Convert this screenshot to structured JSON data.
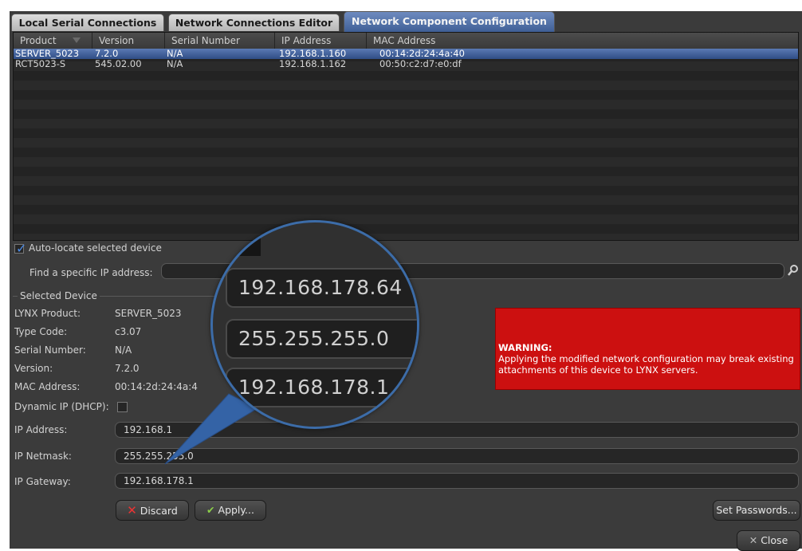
{
  "tabs": [
    {
      "label": "Local Serial Connections"
    },
    {
      "label": "Network Connections Editor"
    },
    {
      "label": "Network Component Configuration"
    }
  ],
  "table": {
    "headers": [
      "Product",
      "Version",
      "Serial Number",
      "IP Address",
      "MAC Address"
    ],
    "rows": [
      {
        "product": "SERVER_5023",
        "version": "7.2.0",
        "serial": "N/A",
        "ip": "192.168.1.160",
        "mac": "00:14:2d:24:4a:40"
      },
      {
        "product": "RCT5023-S",
        "version": "545.02.00",
        "serial": "N/A",
        "ip": "192.168.1.162",
        "mac": "00:50:c2:d7:e0:df"
      }
    ]
  },
  "auto_locate": {
    "label": "Auto-locate selected device",
    "checked": true
  },
  "find_ip": {
    "label": "Find a specific IP address:",
    "value": ""
  },
  "selected_device": {
    "title": "Selected Device",
    "labels": [
      "LYNX Product:",
      "Type Code:",
      "Serial Number:",
      "Version:",
      "MAC Address:"
    ],
    "values": [
      "SERVER_5023",
      "c3.07",
      "N/A",
      "7.2.0",
      "00:14:2d:24:4a:4"
    ]
  },
  "dhcp": {
    "label": "Dynamic IP (DHCP):",
    "checked": false
  },
  "ip_address": {
    "label": "IP Address:",
    "value": "192.168.1"
  },
  "ip_netmask": {
    "label": "IP Netmask:",
    "value": "255.255.255.0"
  },
  "ip_gateway": {
    "label": "IP Gateway:",
    "value": "192.168.178.1"
  },
  "warning": {
    "title": "WARNING:",
    "text": "Applying the modified network configuration may break existing attachments of this device to LYNX servers."
  },
  "zoom": {
    "ip": "192.168.178.64",
    "netmask": "255.255.255.0",
    "gateway": "192.168.178.1"
  },
  "buttons": {
    "discard": "Discard",
    "apply": "Apply...",
    "set_passwords": "Set Passwords...",
    "close": "Close"
  },
  "colors": {
    "accent": "#3f5f96",
    "warning": "#cc1010",
    "panel": "#3b3b3b"
  }
}
